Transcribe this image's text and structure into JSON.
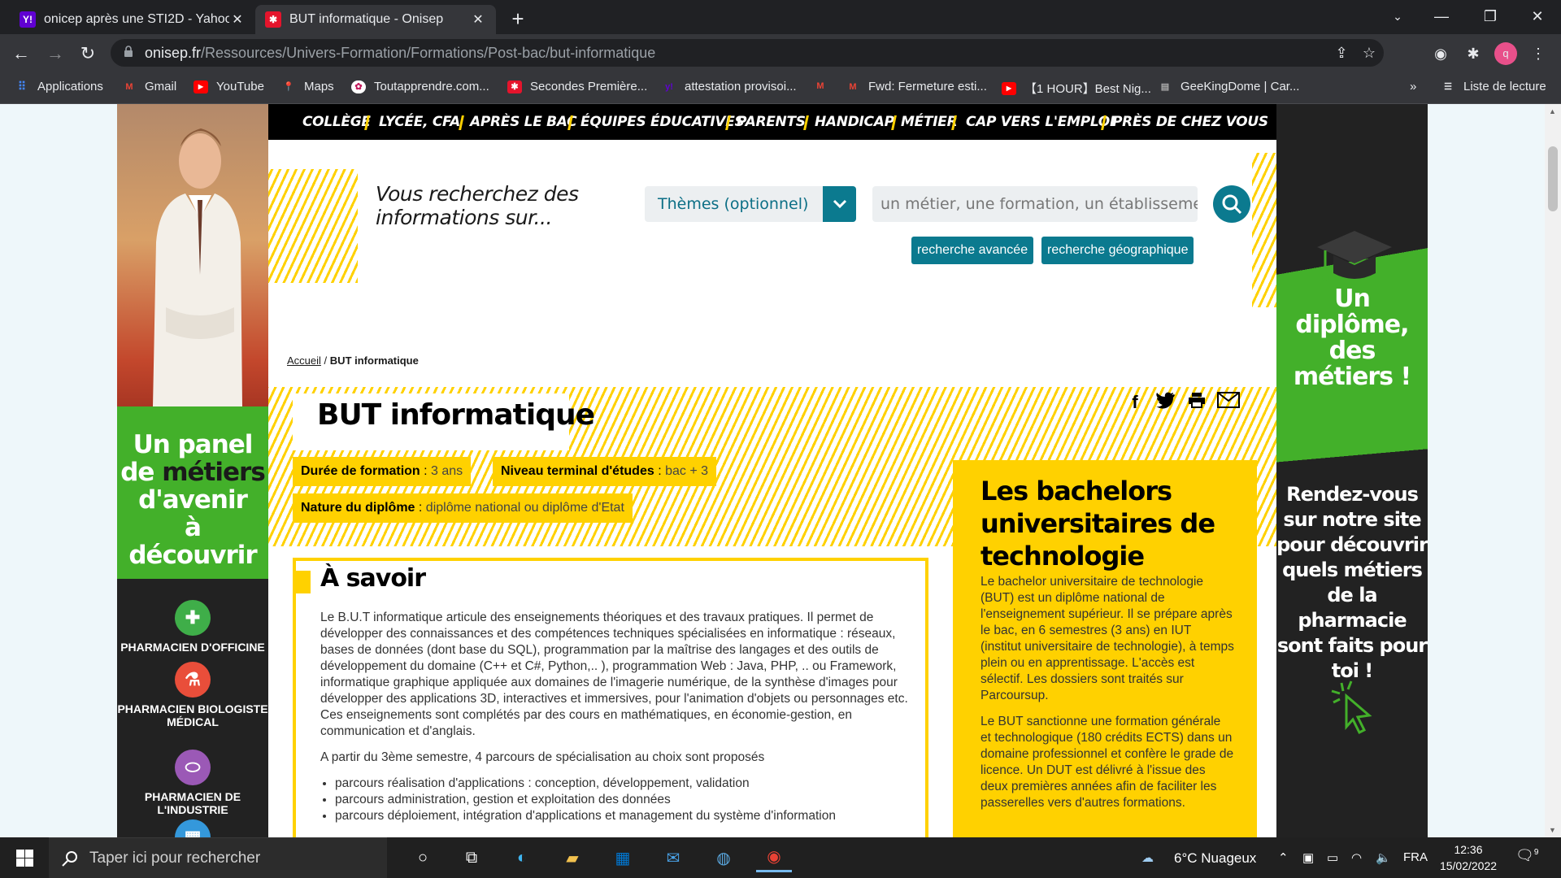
{
  "browser": {
    "tabs": [
      {
        "title": "onicep après une STI2D - Yahoo",
        "favicon": "Y!"
      },
      {
        "title": "BUT informatique - Onisep",
        "favicon": "✱"
      }
    ],
    "url_host": "onisep.fr",
    "url_path": "/Ressources/Univers-Formation/Formations/Post-bac/but-informatique",
    "bookmarks": [
      "Applications",
      "Gmail",
      "YouTube",
      "Maps",
      "Toutapprendre.com...",
      "Secondes Première...",
      "attestation provisoi...",
      "",
      "Fwd: Fermeture esti...",
      "【1 HOUR】Best Nig...",
      "GeeKingDome | Car..."
    ],
    "reading_list": "Liste de lecture",
    "more": "»",
    "profile_initial": "q"
  },
  "nav": [
    "COLLÈGE",
    "LYCÉE, CFA",
    "APRÈS LE BAC",
    "ÉQUIPES ÉDUCATIVES",
    "PARENTS",
    "HANDICAP",
    "MÉTIER",
    "CAP VERS L'EMPLOI",
    "PRÈS DE CHEZ VOUS"
  ],
  "search": {
    "question": "Vous recherchez des informations sur...",
    "themes_label": "Thèmes (optionnel)",
    "placeholder": "un métier, une formation, un établissement",
    "advanced": "recherche avancée",
    "geo": "recherche géographique"
  },
  "breadcrumb": {
    "home": "Accueil",
    "sep": "/",
    "current": "BUT informatique"
  },
  "page_title": "BUT informatique",
  "facts": [
    {
      "label": "Durée de formation",
      "value": "3 ans"
    },
    {
      "label": "Niveau terminal d'études",
      "value": "bac + 3"
    },
    {
      "label": "Nature du diplôme",
      "value": "diplôme national ou diplôme d'Etat"
    }
  ],
  "asavoir": {
    "title": "À savoir",
    "p1": "Le B.U.T informatique articule des enseignements théoriques et des travaux pratiques. Il permet de développer des connaissances et des compétences techniques spécialisées en informatique : réseaux, bases de données (dont base du SQL), programmation par la maîtrise des langages et des outils de développement du domaine (C++ et C#, Python,.. ), programmation Web : Java, PHP, .. ou Framework, informatique graphique appliquée aux domaines de l'imagerie numérique, de la synthèse d'images pour développer des applications 3D, interactives et immersives, pour l'animation d'objets ou personnages etc. Ces enseignements sont complétés par des cours en mathématiques, en économie-gestion, en communication et d'anglais.",
    "p2": "A partir du 3ème semestre, 4 parcours de spécialisation au choix sont proposés",
    "items": [
      "parcours réalisation d'applications : conception, développement, validation",
      "parcours administration, gestion et exploitation des données",
      "parcours déploiement, intégration d'applications et management du système d'information"
    ]
  },
  "bachelors": {
    "title": "Les bachelors universitaires de technologie",
    "p1": "Le bachelor universitaire de technologie (BUT) est un diplôme national de l'enseignement supérieur. Il se prépare après le bac, en 6 semestres (3 ans) en IUT (institut universitaire de technologie), à temps plein ou en apprentissage. L'accès est sélectif. Les dossiers sont traités sur Parcoursup.",
    "p2": "Le BUT sanctionne une formation générale et technologique (180 crédits ECTS) dans un domaine professionnel et confère le grade de licence.  Un DUT est délivré à l'issue des deux premières années afin de faciliter les passerelles vers d'autres formations."
  },
  "left_ad": {
    "headline": [
      "Un panel",
      "de",
      "métiers",
      "d'avenir",
      "à découvrir"
    ],
    "items": [
      "PHARMACIEN D'OFFICINE",
      "PHARMACIEN BIOLOGISTE MÉDICAL",
      "PHARMACIEN DE L'INDUSTRIE"
    ]
  },
  "right_ad": {
    "headline": "Un diplôme, des métiers !",
    "text": "Rendez-vous sur notre site pour découvrir quels métiers de la pharmacie sont faits pour toi !"
  },
  "taskbar": {
    "search_placeholder": "Taper ici pour rechercher",
    "weather": "6°C  Nuageux",
    "lang": "FRA",
    "time": "12:36",
    "date": "15/02/2022",
    "notif_count": "9"
  },
  "colors": {
    "accent_yellow": "#ffd100",
    "teal": "#0b7a8f",
    "ad_green": "#43b02a"
  }
}
